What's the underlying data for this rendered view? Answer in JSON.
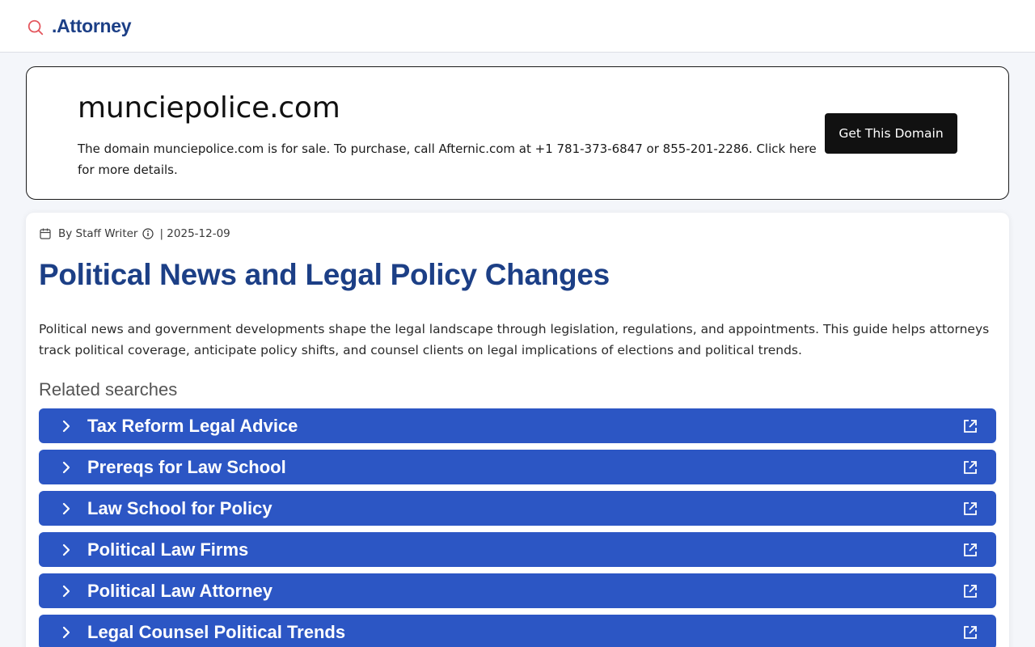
{
  "header": {
    "logo_text": ".Attorney",
    "logo_icon": "search-icon",
    "logo_icon_color": "#e4585f",
    "brand_color": "#1c3f86"
  },
  "banner": {
    "domain": "munciepolice.com",
    "description": "The domain munciepolice.com is for sale. To purchase, call Afternic.com at +1 781-373-6847 or 855-201-2286. Click here for more details.",
    "button_label": "Get This Domain"
  },
  "article": {
    "author": "By Staff Writer",
    "date_sep": "| 2025-12-09",
    "title": "Political News and Legal Policy Changes",
    "lead": "Political news and government developments shape the legal landscape through legislation, regulations, and appointments. This guide helps attorneys track political coverage, anticipate policy shifts, and counsel clients on legal implications of elections and political trends."
  },
  "related": {
    "title": "Related searches",
    "accent": "#2c56c4",
    "items": [
      {
        "label": "Tax Reform Legal Advice"
      },
      {
        "label": "Prereqs for Law School"
      },
      {
        "label": "Law School for Policy"
      },
      {
        "label": "Political Law Firms"
      },
      {
        "label": "Political Law Attorney"
      },
      {
        "label": "Legal Counsel Political Trends"
      }
    ]
  }
}
